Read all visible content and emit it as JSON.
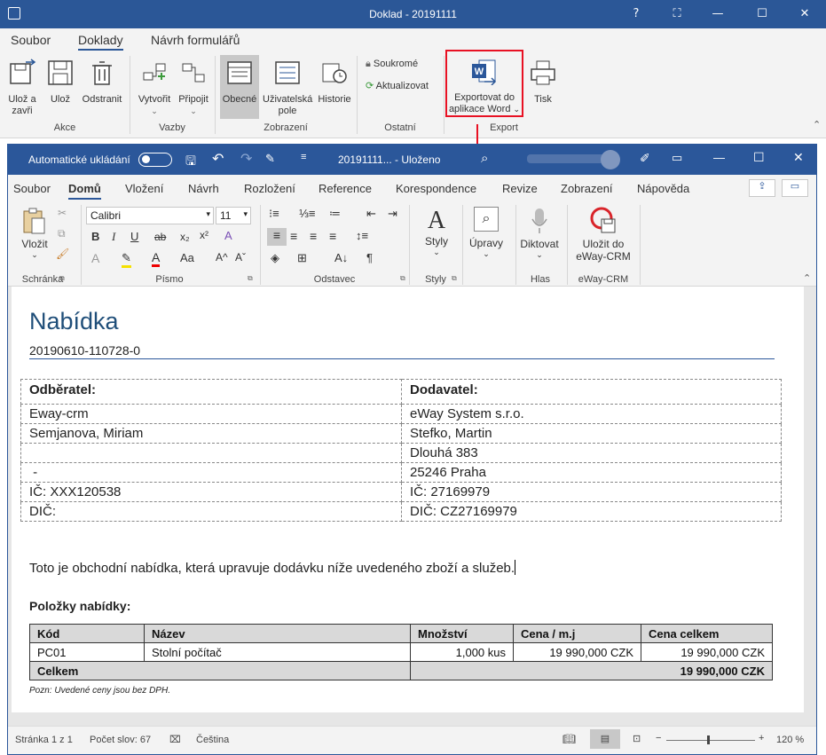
{
  "outer_window": {
    "title": "Doklad - 20191111",
    "tabs": [
      "Soubor",
      "Doklady",
      "Návrh formulářů"
    ],
    "active_tab": "Doklady",
    "ribbon": {
      "akce": {
        "label": "Akce",
        "uloz_a_zavri_1": "Ulož a",
        "uloz_a_zavri_2": "zavři",
        "uloz": "Ulož",
        "odstranit": "Odstranit"
      },
      "vazby": {
        "label": "Vazby",
        "vytvorit": "Vytvořit",
        "pripojit": "Připojit"
      },
      "zobrazeni": {
        "label": "Zobrazení",
        "obecne": "Obecné",
        "uzivatelska_1": "Uživatelská",
        "uzivatelska_2": "pole",
        "historie": "Historie"
      },
      "ostatni": {
        "label": "Ostatní",
        "soukrome": "Soukromé",
        "aktualizovat": "Aktualizovat"
      },
      "export": {
        "label": "Export",
        "export_word_1": "Exportovat do",
        "export_word_2": "aplikace Word",
        "tisk": "Tisk"
      }
    },
    "highlight_color": "#e81123"
  },
  "word": {
    "autosave_label": "Automatické ukládání",
    "title": "20191111... - Uloženo",
    "tabs": [
      "Soubor",
      "Domů",
      "Vložení",
      "Návrh",
      "Rozložení",
      "Reference",
      "Korespondence",
      "Revize",
      "Zobrazení",
      "Nápověda"
    ],
    "active_tab": "Domů",
    "ribbon": {
      "schranka": {
        "label": "Schránka",
        "vlozit": "Vložit"
      },
      "pismo": {
        "label": "Písmo",
        "font": "Calibri",
        "size": "11"
      },
      "odstavec": {
        "label": "Odstavec"
      },
      "styly": {
        "label": "Styly",
        "button": "Styly"
      },
      "upravy": {
        "button": "Úpravy"
      },
      "hlas": {
        "label": "Hlas",
        "button": "Diktovat"
      },
      "eway": {
        "label": "eWay-CRM",
        "button_1": "Uložit do",
        "button_2": "eWay-CRM"
      }
    },
    "status": {
      "page": "Stránka 1 z 1",
      "words": "Počet slov: 67",
      "language": "Čeština",
      "zoom": "120 %"
    }
  },
  "document": {
    "title": "Nabídka",
    "number": "20190610-110728-0",
    "customer_header": "Odběratel:",
    "supplier_header": "Dodavatel:",
    "rows": [
      [
        "Eway-crm",
        "eWay System s.r.o."
      ],
      [
        "Semjanova, Miriam",
        "Stefko, Martin"
      ],
      [
        "",
        "Dlouhá 383"
      ],
      [
        " -",
        "25246 Praha"
      ],
      [
        "IČ: XXX120538",
        "IČ: 27169979"
      ],
      [
        "DIČ:",
        "DIČ: CZ27169979"
      ]
    ],
    "intro": "Toto je obchodní nabídka, která upravuje dodávku níže uvedeného zboží a služeb.",
    "items_heading": "Položky nabídky:",
    "items_columns": [
      "Kód",
      "Název",
      "Množství",
      "Cena / m.j",
      "Cena celkem"
    ],
    "items": [
      [
        "PC01",
        "Stolní počítač",
        "1,000 kus",
        "19 990,000 CZK",
        "19 990,000 CZK"
      ]
    ],
    "total_label": "Celkem",
    "total_value": "19 990,000 CZK",
    "note": "Pozn: Uvedené ceny jsou bez DPH."
  },
  "colors": {
    "word_blue": "#2b579a",
    "heading_blue": "#1f4e79",
    "accent_red": "#e81123"
  }
}
